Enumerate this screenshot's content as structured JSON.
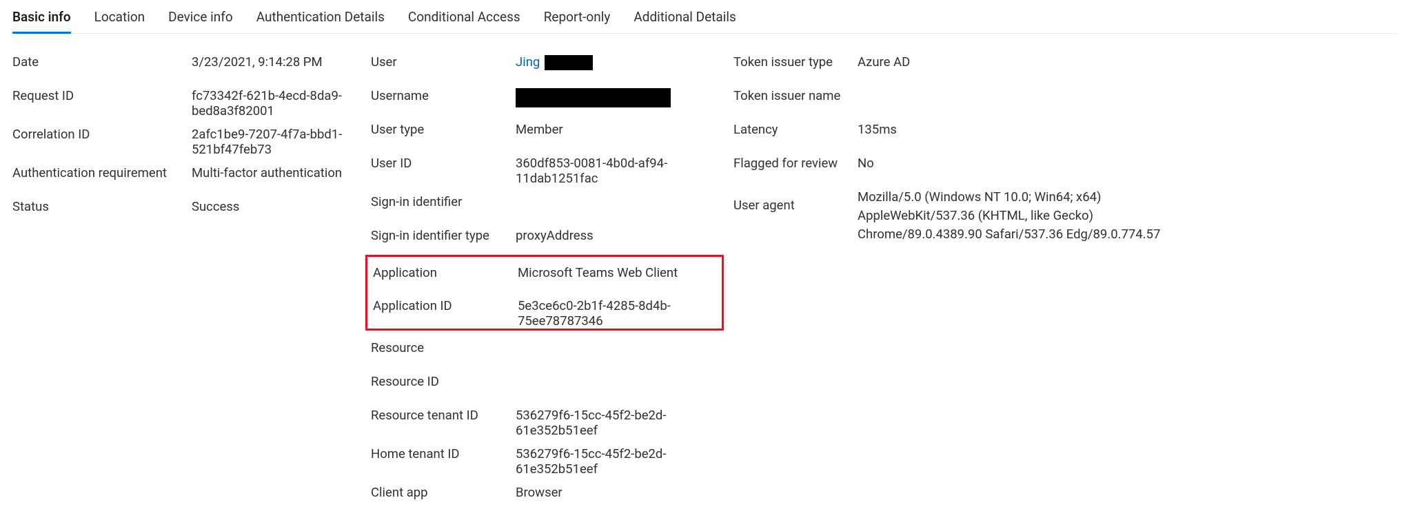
{
  "tabs": {
    "basic_info": "Basic info",
    "location": "Location",
    "device_info": "Device info",
    "auth_details": "Authentication Details",
    "conditional_access": "Conditional Access",
    "report_only": "Report-only",
    "additional_details": "Additional Details"
  },
  "col1": {
    "date": {
      "label": "Date",
      "value": "3/23/2021, 9:14:28 PM"
    },
    "request_id": {
      "label": "Request ID",
      "value": "fc73342f-621b-4ecd-8da9-bed8a3f82001"
    },
    "correlation_id": {
      "label": "Correlation ID",
      "value": "2afc1be9-7207-4f7a-bbd1-521bf47feb73"
    },
    "auth_req": {
      "label": "Authentication requirement",
      "value": "Multi-factor authentication"
    },
    "status": {
      "label": "Status",
      "value": "Success"
    }
  },
  "col2": {
    "user": {
      "label": "User",
      "link_text": "Jing"
    },
    "username": {
      "label": "Username"
    },
    "user_type": {
      "label": "User type",
      "value": "Member"
    },
    "user_id": {
      "label": "User ID",
      "value": "360df853-0081-4b0d-af94-11dab1251fac"
    },
    "signin_identifier": {
      "label": "Sign-in identifier",
      "value": ""
    },
    "signin_identifier_type": {
      "label": "Sign-in identifier type",
      "value": "proxyAddress"
    },
    "application": {
      "label": "Application",
      "value": "Microsoft Teams Web Client"
    },
    "application_id": {
      "label": "Application ID",
      "value": "5e3ce6c0-2b1f-4285-8d4b-75ee78787346"
    },
    "resource": {
      "label": "Resource",
      "value": ""
    },
    "resource_id": {
      "label": "Resource ID",
      "value": ""
    },
    "resource_tenant_id": {
      "label": "Resource tenant ID",
      "value": "536279f6-15cc-45f2-be2d-61e352b51eef"
    },
    "home_tenant_id": {
      "label": "Home tenant ID",
      "value": "536279f6-15cc-45f2-be2d-61e352b51eef"
    },
    "client_app": {
      "label": "Client app",
      "value": "Browser"
    }
  },
  "col3": {
    "token_issuer_type": {
      "label": "Token issuer type",
      "value": "Azure AD"
    },
    "token_issuer_name": {
      "label": "Token issuer name",
      "value": ""
    },
    "latency": {
      "label": "Latency",
      "value": "135ms"
    },
    "flagged": {
      "label": "Flagged for review",
      "value": "No"
    },
    "user_agent": {
      "label": "User agent",
      "line1": "Mozilla/5.0 (Windows NT 10.0; Win64; x64)",
      "line2": "AppleWebKit/537.36 (KHTML, like Gecko)",
      "line3": "Chrome/89.0.4389.90 Safari/537.36 Edg/89.0.774.57"
    }
  }
}
